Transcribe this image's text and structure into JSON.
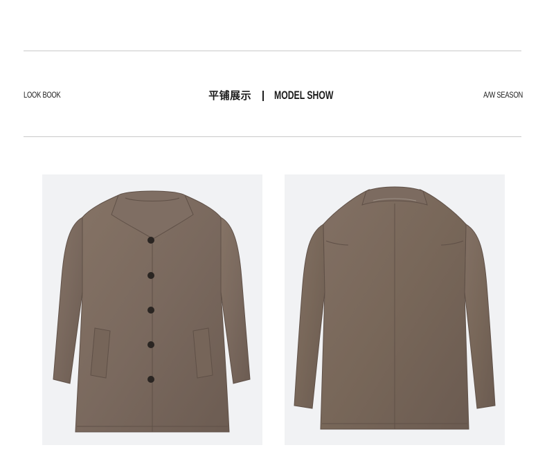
{
  "header": {
    "left_tag": "LOOK BOOK",
    "title_cn": "平铺展示",
    "title_en": "MODEL SHOW",
    "right_tag": "A/W SEASON"
  },
  "colors": {
    "coat": "#7b6a5f",
    "coat_shadow": "#645449",
    "coat_light": "#8b7a6e",
    "background": "#f1f2f4",
    "rule": "#c9c9c9",
    "button": "#2a2522"
  },
  "images": [
    {
      "name": "coat-front",
      "alt": "wool coat front view",
      "buttons": 5
    },
    {
      "name": "coat-back",
      "alt": "wool coat back view"
    }
  ]
}
